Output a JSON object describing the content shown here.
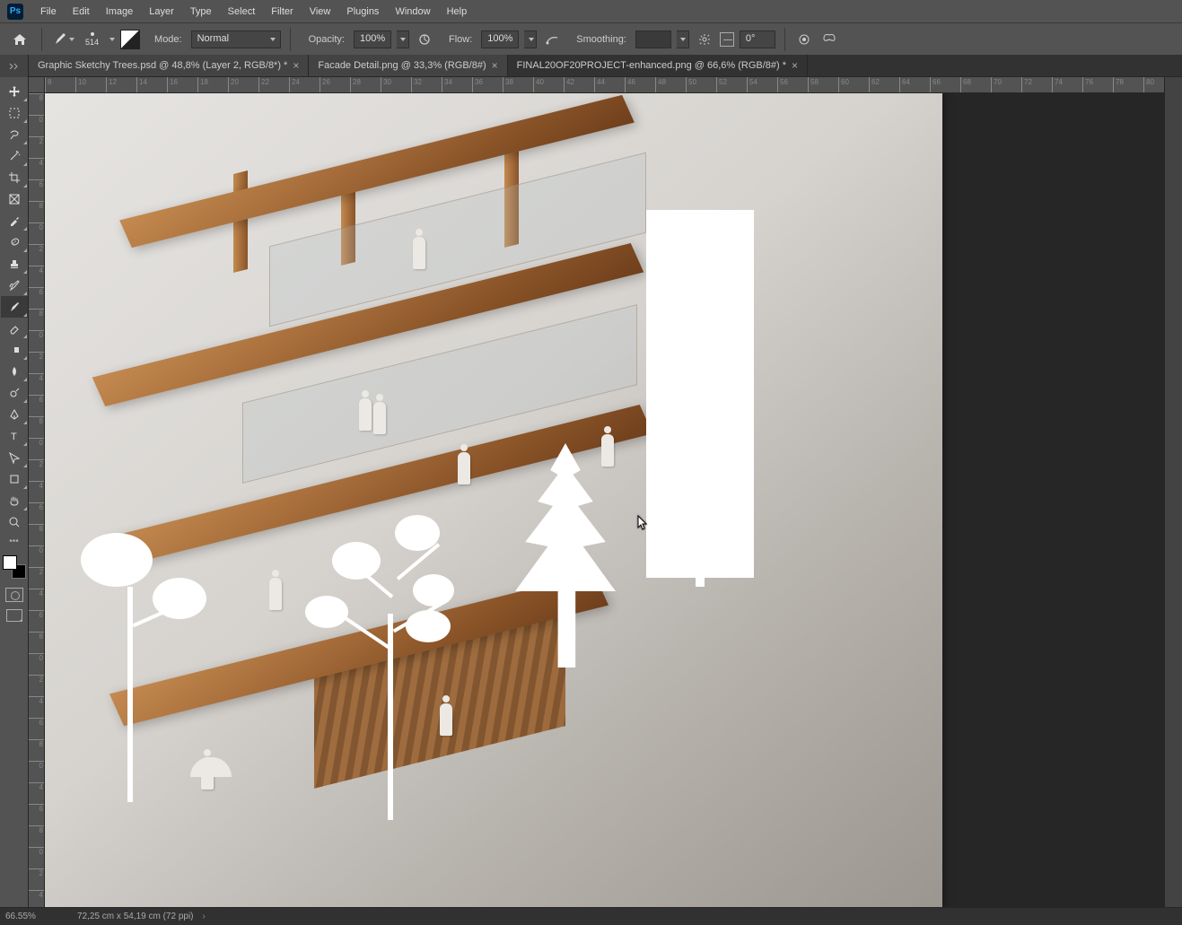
{
  "menubar": {
    "items": [
      "File",
      "Edit",
      "Image",
      "Layer",
      "Type",
      "Select",
      "Filter",
      "View",
      "Plugins",
      "Window",
      "Help"
    ]
  },
  "options": {
    "brush_size": "514",
    "mode_label": "Mode:",
    "mode_value": "Normal",
    "opacity_label": "Opacity:",
    "opacity_value": "100%",
    "flow_label": "Flow:",
    "flow_value": "100%",
    "smoothing_label": "Smoothing:",
    "angle_value": "0°"
  },
  "tabs": [
    {
      "label": "Graphic Sketchy Trees.psd @ 48,8% (Layer 2, RGB/8*) *",
      "active": false
    },
    {
      "label": "Facade Detail.png @ 33,3% (RGB/8#)",
      "active": false
    },
    {
      "label": "FINAL20OF20PROJECT-enhanced.png @ 66,6% (RGB/8#) *",
      "active": true
    }
  ],
  "ruler_h": [
    8,
    10,
    12,
    14,
    16,
    18,
    20,
    22,
    24,
    26,
    28,
    30,
    32,
    34,
    36,
    38,
    40,
    42,
    44,
    46,
    48,
    50,
    52,
    54,
    56,
    58,
    60,
    62,
    64,
    66,
    68,
    70,
    72,
    74,
    76,
    78,
    80
  ],
  "ruler_v": [
    8,
    0,
    2,
    4,
    6,
    8,
    0,
    2,
    4,
    6,
    8,
    0,
    2,
    4,
    6,
    8,
    0,
    2,
    4,
    6,
    8,
    0,
    2,
    4,
    6,
    8,
    0,
    2,
    4,
    6,
    8,
    0,
    4,
    6,
    8,
    0,
    2,
    4
  ],
  "ruler_v_tens": [
    "",
    "1",
    "1",
    "1",
    "1",
    "1",
    "2",
    "2",
    "2",
    "2",
    "2",
    "3",
    "3",
    "3",
    "3",
    "3",
    "4",
    "4",
    "4",
    "4",
    "4",
    "5",
    "5"
  ],
  "status": {
    "zoom": "66.55%",
    "doc": "72,25 cm x 54,19 cm (72 ppi)"
  },
  "tools": [
    "move",
    "marquee",
    "lasso",
    "wand",
    "crop",
    "frame",
    "eyedropper",
    "heal",
    "brush",
    "stamp",
    "history",
    "eraser",
    "gradient",
    "blur",
    "dodge",
    "pen",
    "type",
    "path",
    "shape",
    "hand",
    "zoom"
  ]
}
